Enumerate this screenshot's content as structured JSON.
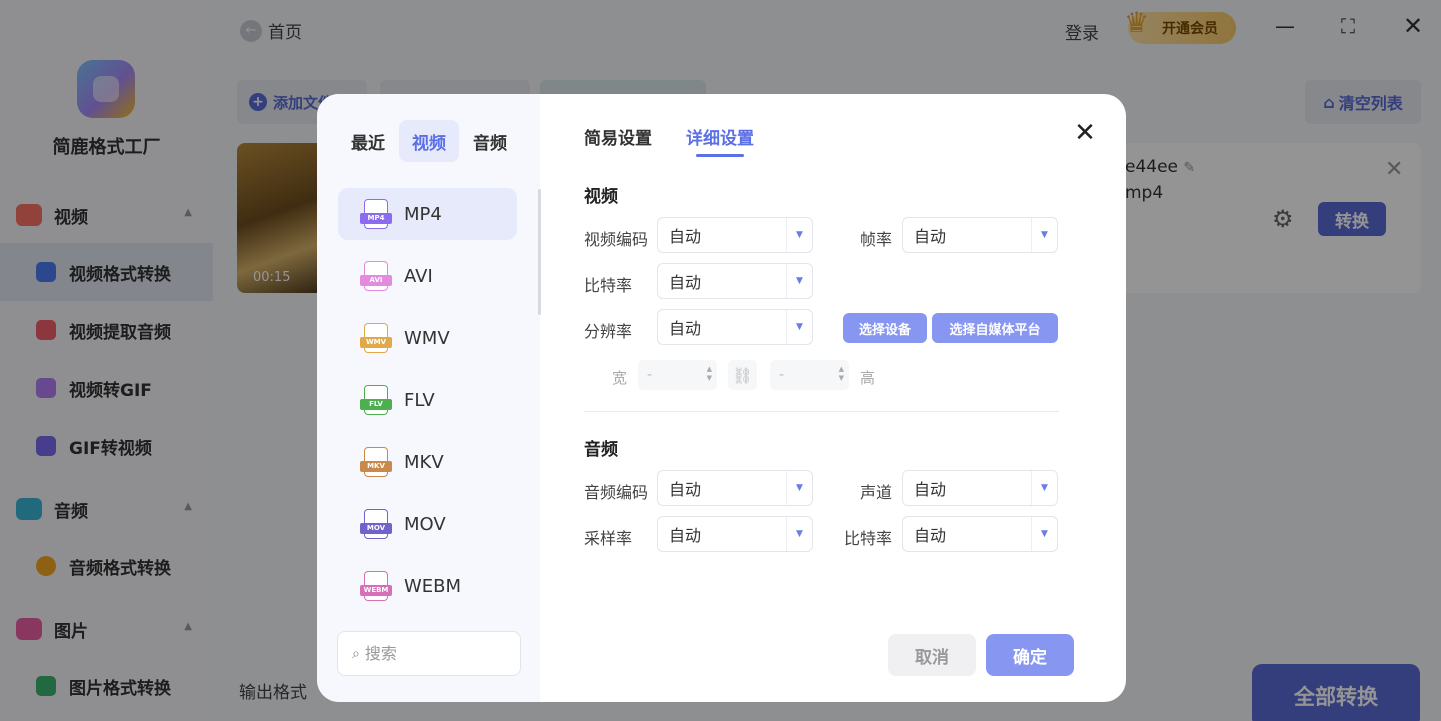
{
  "app": {
    "name": "简鹿格式工厂",
    "home_label": "首页",
    "login_label": "登录",
    "vip_label": "开通会员",
    "vip_badge": "VIP"
  },
  "sidebar": {
    "groups": [
      {
        "label": "视频",
        "color": "#f97366",
        "items": [
          {
            "label": "视频格式转换",
            "color": "#4d7cf3"
          },
          {
            "label": "视频提取音频",
            "color": "#f0606a"
          },
          {
            "label": "视频转GIF",
            "color": "#b47cf5"
          },
          {
            "label": "GIF转视频",
            "color": "#7a6cf0"
          }
        ]
      },
      {
        "label": "音频",
        "color": "#3ab7d9",
        "items": [
          {
            "label": "音频格式转换",
            "color": "#f5a623"
          }
        ]
      },
      {
        "label": "图片",
        "color": "#ee5fa6",
        "items": [
          {
            "label": "图片格式转换",
            "color": "#3cb46e"
          }
        ]
      }
    ]
  },
  "toolbar": {
    "add_file_label": "添加文件",
    "clear_list_label": "清空列表"
  },
  "file": {
    "duration": "00:15",
    "name_fragment": "e44ee",
    "ext_fragment": "mp4",
    "convert_label": "转换"
  },
  "footer": {
    "output_format_label": "输出格式",
    "convert_all_label": "全部转换"
  },
  "modal": {
    "category_tabs": [
      {
        "label": "最近",
        "active": false
      },
      {
        "label": "视频",
        "active": true
      },
      {
        "label": "音频",
        "active": false
      }
    ],
    "formats": [
      {
        "label": "MP4",
        "badge": "MP4",
        "color": "#8b6cf0",
        "active": true
      },
      {
        "label": "AVI",
        "badge": "AVI",
        "color": "#e48be0",
        "active": false
      },
      {
        "label": "WMV",
        "badge": "WMV",
        "color": "#e0a94a",
        "active": false
      },
      {
        "label": "FLV",
        "badge": "FLV",
        "color": "#4caf50",
        "active": false
      },
      {
        "label": "MKV",
        "badge": "MKV",
        "color": "#c8894a",
        "active": false
      },
      {
        "label": "MOV",
        "badge": "MOV",
        "color": "#6f63c9",
        "active": false
      },
      {
        "label": "WEBM",
        "badge": "WEBM",
        "color": "#d46fb8",
        "active": false
      }
    ],
    "search_placeholder": "搜索",
    "settings_tabs": [
      {
        "label": "简易设置",
        "active": false
      },
      {
        "label": "详细设置",
        "active": true
      }
    ],
    "video": {
      "title": "视频",
      "codec_label": "视频编码",
      "codec_value": "自动",
      "framerate_label": "帧率",
      "framerate_value": "自动",
      "bitrate_label": "比特率",
      "bitrate_value": "自动",
      "resolution_label": "分辨率",
      "resolution_value": "自动",
      "select_device_label": "选择设备",
      "select_platform_label": "选择自媒体平台",
      "width_label": "宽",
      "width_value": "-",
      "height_label": "高",
      "height_value": "-"
    },
    "audio": {
      "title": "音频",
      "codec_label": "音频编码",
      "codec_value": "自动",
      "channel_label": "声道",
      "channel_value": "自动",
      "samplerate_label": "采样率",
      "samplerate_value": "自动",
      "bitrate_label": "比特率",
      "bitrate_value": "自动"
    },
    "cancel_label": "取消",
    "ok_label": "确定"
  }
}
